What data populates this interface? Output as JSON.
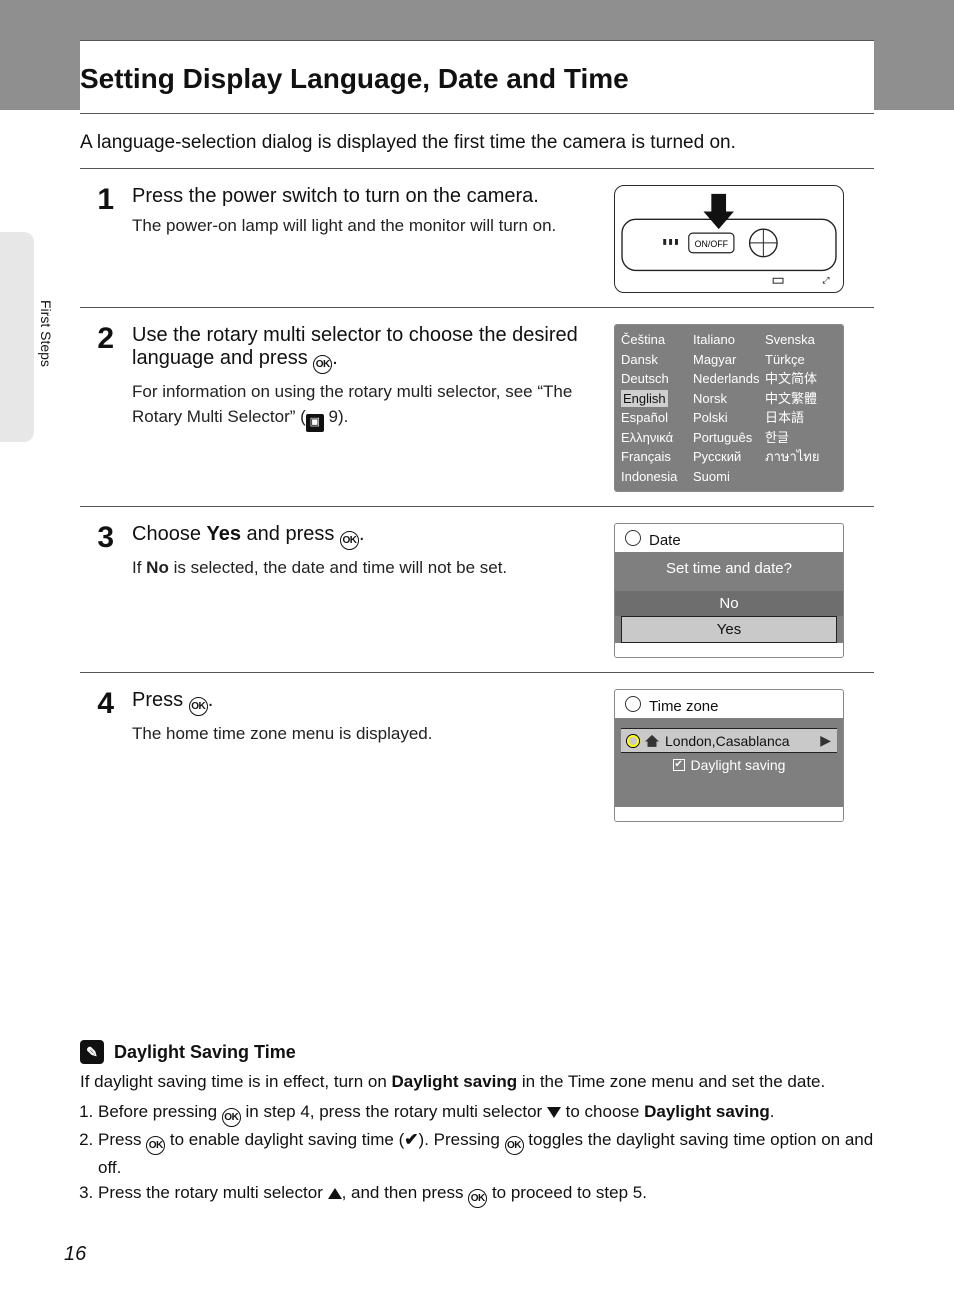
{
  "page_number": "16",
  "side_tab": "First Steps",
  "title": "Setting Display Language, Date and Time",
  "intro": "A language-selection dialog is displayed the first time the camera is turned on.",
  "steps": {
    "s1": {
      "num": "1",
      "head": "Press the power switch to turn on the camera.",
      "sub": "The power-on lamp will light and the monitor will turn on."
    },
    "s2": {
      "num": "2",
      "head_a": "Use the rotary multi selector to choose the desired language and press ",
      "head_b": ".",
      "sub_a": "For information on using the rotary multi selector, see “The Rotary Multi Selector” (",
      "sub_b": " 9)."
    },
    "s3": {
      "num": "3",
      "head_a": "Choose ",
      "head_bold": "Yes",
      "head_b": " and press ",
      "head_c": ".",
      "sub_a": "If ",
      "sub_bold": "No",
      "sub_b": " is selected, the date and time will not be set."
    },
    "s4": {
      "num": "4",
      "head_a": "Press ",
      "head_b": ".",
      "sub": "The home time zone menu is displayed."
    }
  },
  "lang_grid": {
    "col1": [
      "Čeština",
      "Dansk",
      "Deutsch",
      "English",
      "Español",
      "Ελληνικά",
      "Français",
      "Indonesia"
    ],
    "col2": [
      "Italiano",
      "Magyar",
      "Nederlands",
      "Norsk",
      "Polski",
      "Português",
      "Русский",
      "Suomi"
    ],
    "col3": [
      "Svenska",
      "Türkçe",
      "中文简体",
      "中文繁體",
      "日本語",
      "한글",
      "ภาษาไทย",
      ""
    ],
    "selected": "English"
  },
  "lcd_date": {
    "title": "Date",
    "question": "Set time and date?",
    "no": "No",
    "yes": "Yes"
  },
  "lcd_tz": {
    "title": "Time zone",
    "value": "London,Casablanca",
    "daylight": "Daylight saving"
  },
  "note": {
    "title": "Daylight Saving Time",
    "intro_a": "If daylight saving time is in effect, turn on ",
    "intro_bold": "Daylight saving",
    "intro_b": " in the Time zone menu and set the date.",
    "li1_a": "Before pressing ",
    "li1_b": " in step 4, press the rotary multi selector ",
    "li1_c": " to choose ",
    "li1_bold": "Daylight saving",
    "li1_d": ".",
    "li2_a": "Press ",
    "li2_b": " to enable daylight saving time (",
    "li2_c": "). Pressing ",
    "li2_d": " toggles the daylight saving time option on and off.",
    "li3_a": "Press the rotary multi selector ",
    "li3_b": ", and then press ",
    "li3_c": " to proceed to step 5."
  },
  "icons": {
    "ok": "OK",
    "onoff": "ON/OFF"
  }
}
